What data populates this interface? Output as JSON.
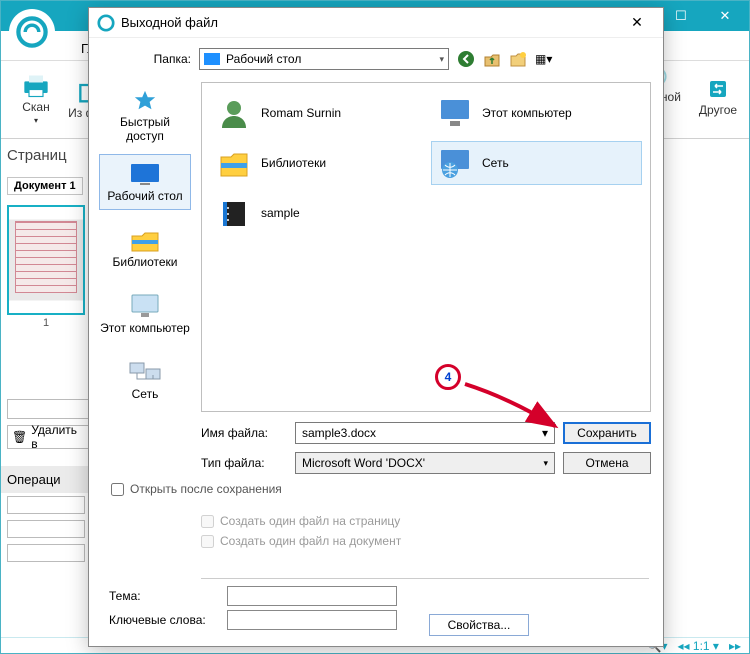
{
  "app": {
    "ribbon_tab": "Гл",
    "scan": "Скан",
    "from_file": "Из файл",
    "pages_header": "Страниц",
    "document_tab": "Документ 1",
    "delete": "Удалить в",
    "operations": "Операци",
    "output_file": "Выходной файл",
    "other": "Другое",
    "zoom": "1:1"
  },
  "dialog": {
    "title": "Выходной файл",
    "folder_label": "Папка:",
    "folder_value": "Рабочий стол",
    "places": {
      "quick": "Быстрый доступ",
      "desktop": "Рабочий стол",
      "libraries": "Библиотеки",
      "this_pc": "Этот компьютер",
      "network": "Сеть"
    },
    "items": {
      "user": "Romam Surnin",
      "libraries": "Библиотеки",
      "sample": "sample",
      "this_pc": "Этот компьютер",
      "network": "Сеть"
    },
    "filename_label": "Имя файла:",
    "filename_value": "sample3.docx",
    "filetype_label": "Тип файла:",
    "filetype_value": "Microsoft Word 'DOCX'",
    "save": "Сохранить",
    "cancel": "Отмена",
    "open_after": "Открыть после сохранения",
    "one_per_page": "Создать один файл на страницу",
    "one_per_doc": "Создать один файл на документ",
    "topic": "Тема:",
    "keywords": "Ключевые слова:",
    "properties": "Свойства...",
    "annotation_number": "4"
  }
}
